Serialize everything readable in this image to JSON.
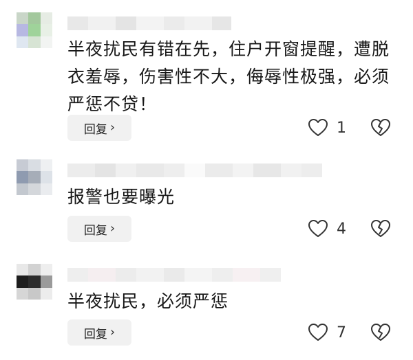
{
  "comments": [
    {
      "text": "半夜扰民有错在先，住户开窗提醒，遭脱衣羞辱，伤害性不大，侮辱性极强，必须严惩不贷！",
      "reply_label": "回复",
      "like_count": "1"
    },
    {
      "text": "报警也要曝光",
      "reply_label": "回复",
      "like_count": "4"
    },
    {
      "text": "半夜扰民，必须严惩",
      "reply_label": "回复",
      "like_count": "7"
    }
  ],
  "icons": {
    "like": "heart-outline-icon",
    "dislike": "broken-heart-outline-icon",
    "reply_chevron": "chevron-right-icon"
  },
  "colors": {
    "reply_bg": "#f1f1f1",
    "text": "#171717",
    "icon": "#333333"
  }
}
